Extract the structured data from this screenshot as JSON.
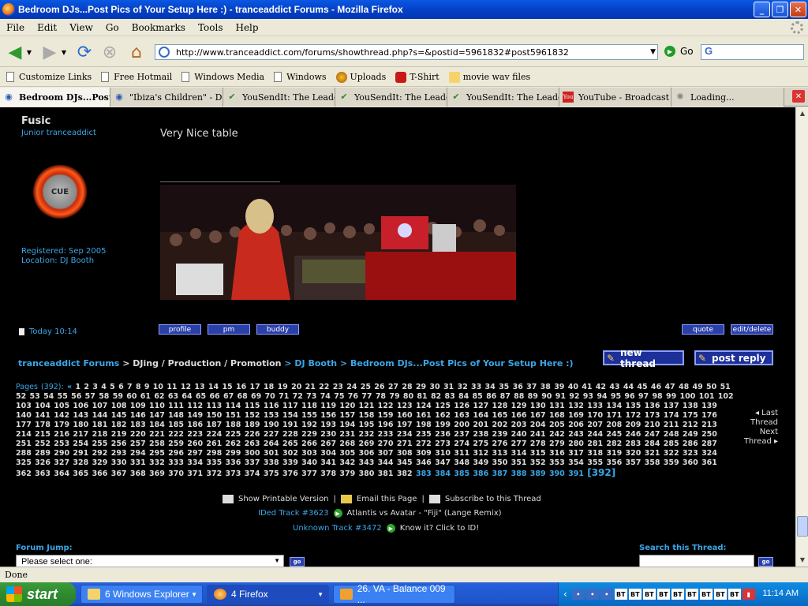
{
  "window": {
    "title": "Bedroom DJs...Post Pics of Your Setup Here :) - tranceaddict Forums - Mozilla Firefox"
  },
  "menu": [
    "File",
    "Edit",
    "View",
    "Go",
    "Bookmarks",
    "Tools",
    "Help"
  ],
  "nav": {
    "url": "http://www.tranceaddict.com/forums/showthread.php?s=&postid=5961832#post5961832",
    "go_label": "Go",
    "search_value": "G"
  },
  "bookmarks": [
    "Customize Links",
    "Free Hotmail",
    "Windows Media",
    "Windows",
    "Uploads",
    "T-Shirt",
    "movie wav files"
  ],
  "tabs": [
    {
      "label": "Bedroom DJs...Post ...",
      "icon": "tranceaddict-icon"
    },
    {
      "label": "\"Ibiza's Children\" - Do...",
      "icon": "tranceaddict-icon"
    },
    {
      "label": "YouSendIt: The Leade...",
      "icon": "check-icon"
    },
    {
      "label": "YouSendIt: The Leade...",
      "icon": "check-icon"
    },
    {
      "label": "YouSendIt: The Leade...",
      "icon": "check-icon"
    },
    {
      "label": "YouTube - Broadcast ...",
      "icon": "youtube-icon"
    },
    {
      "label": "Loading...",
      "icon": "loading-icon"
    }
  ],
  "post": {
    "username": "Fusic",
    "user_title": "Junior tranceaddict",
    "avatar_text": "CUE",
    "registered": "Registered: Sep 2005",
    "location": "Location: DJ Booth",
    "message": "Very Nice table",
    "timestamp": "Today 10:14",
    "buttons": {
      "profile": "profile",
      "pm": "pm",
      "buddy": "buddy",
      "quote": "quote",
      "edit": "edit/delete"
    }
  },
  "breadcrumb": {
    "root": "tranceaddict Forums",
    "sep": ">",
    "section": "DJing / Production / Promotion",
    "forum": "DJ Booth",
    "thread": "Bedroom DJs...Post Pics of Your Setup Here :)"
  },
  "actions": {
    "new_thread": "new thread",
    "post_reply": "post reply"
  },
  "pagination": {
    "label": "Pages (392):",
    "first": "«",
    "current": "[392]",
    "last_thread": "Last Thread",
    "next_thread": "Next Thread",
    "total_pages": 392,
    "link_pages_end": 382,
    "dim_pages_start": 383
  },
  "tools": {
    "print": "Show Printable Version",
    "email": "Email this Page",
    "subscribe": "Subscribe to this Thread",
    "sep": "|"
  },
  "ided": {
    "label": "IDed Track #3623",
    "track": "Atlantis vs Avatar - \"Fiji\" (Lange Remix)"
  },
  "unknown": {
    "label": "Unknown Track #3472",
    "action": "Know it? Click to ID!"
  },
  "forum_jump": {
    "label": "Forum Jump:",
    "placeholder": "Please select one:",
    "go": "go"
  },
  "search_thread": {
    "label": "Search this Thread:",
    "go": "go"
  },
  "status": "Done",
  "taskbar": {
    "start": "start",
    "tasks": [
      "6 Windows Explorer",
      "4 Firefox",
      "26. VA - Balance 009 ..."
    ],
    "tray_count": 9,
    "clock": "11:14 AM"
  }
}
